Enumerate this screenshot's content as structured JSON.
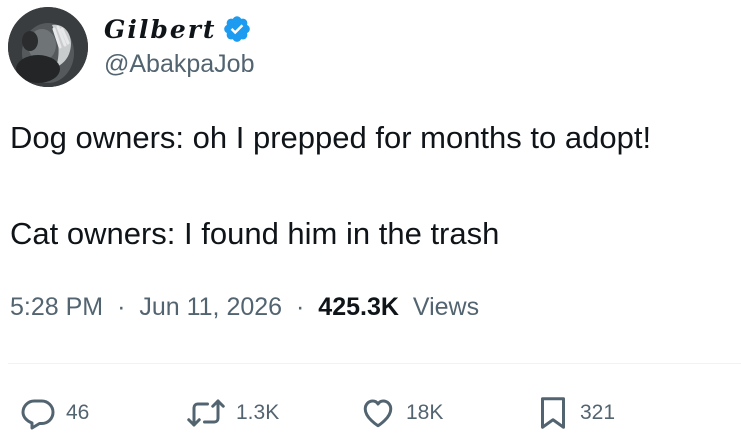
{
  "author": {
    "display_name": "Gilbert",
    "handle": "@AbakpaJob",
    "verified": true,
    "verified_color": "#1d9bf0"
  },
  "tweet": {
    "line1": "Dog owners: oh I prepped for months to adopt!",
    "line2": "Cat owners: I found him in the trash"
  },
  "meta": {
    "time": "5:28 PM",
    "separator": "·",
    "date": "Jun 11, 2026",
    "views_count": "425.3K",
    "views_label": "Views"
  },
  "actions": {
    "reply": {
      "icon": "reply-icon",
      "count": "46"
    },
    "retweet": {
      "icon": "retweet-icon",
      "count": "1.3K"
    },
    "like": {
      "icon": "heart-icon",
      "count": "18K"
    },
    "bookmark": {
      "icon": "bookmark-icon",
      "count": "321"
    }
  },
  "colors": {
    "text_primary": "#0f1419",
    "text_secondary": "#536471",
    "divider": "#eff3f4"
  }
}
